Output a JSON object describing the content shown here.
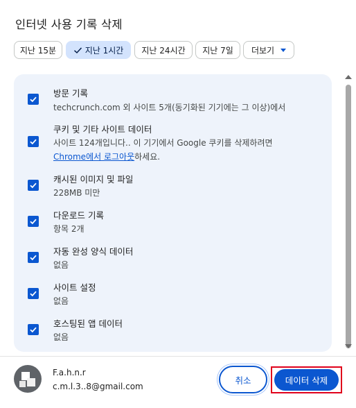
{
  "dialog": {
    "title": "인터넷 사용 기록 삭제"
  },
  "time_chips": [
    {
      "label": "지난 15분",
      "selected": false
    },
    {
      "label": "지난 1시간",
      "selected": true
    },
    {
      "label": "지난 24시간",
      "selected": false
    },
    {
      "label": "지난 7일",
      "selected": false
    }
  ],
  "more_chip": {
    "label": "더보기",
    "icon": "chevron-down-icon"
  },
  "items": [
    {
      "title": "방문 기록",
      "subtitle": "techcrunch.com 외 사이트 5개(동기화된 기기에는 그 이상)에서",
      "checked": true
    },
    {
      "title": "쿠키 및 기타 사이트 데이터",
      "subtitle": "사이트 124개입니다.. 이 기기에서 Google 쿠키를 삭제하려면",
      "link_text": "Chrome에서 로그아웃",
      "subtitle_tail": "하세요.",
      "checked": true
    },
    {
      "title": "캐시된 이미지 및 파일",
      "subtitle": "228MB 미만",
      "checked": true
    },
    {
      "title": "다운로드 기록",
      "subtitle": "항목 2개",
      "checked": true
    },
    {
      "title": "자동 완성 양식 데이터",
      "subtitle": "없음",
      "checked": true
    },
    {
      "title": "사이트 설정",
      "subtitle": "없음",
      "checked": true
    },
    {
      "title": "호스팅된 앱 데이터",
      "subtitle": "없음",
      "checked": true
    }
  ],
  "account": {
    "name": "F.a.h.n.r",
    "email": "c.m.l.3..8@gmail.com"
  },
  "buttons": {
    "cancel": "취소",
    "delete": "데이터 삭제"
  },
  "colors": {
    "accent": "#0b57d0",
    "selected_chip": "#d3e3fd",
    "panel_bg": "#eef3fb",
    "highlight_frame": "#e0001b"
  }
}
